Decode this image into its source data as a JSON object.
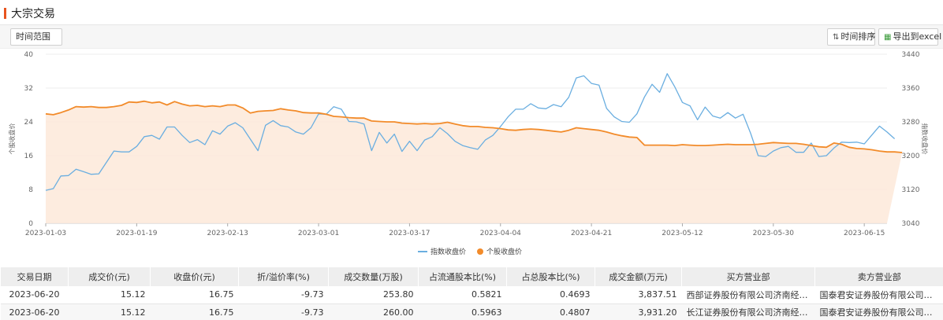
{
  "panel": {
    "title": "大宗交易"
  },
  "toolbar": {
    "range_label": "时间范围",
    "sort_label": "时间排序",
    "sort_icon": "sort-icon",
    "export_label": "导出到excel",
    "export_icon": "excel-icon"
  },
  "chart_data": {
    "type": "line",
    "x": [
      "2023-01-03",
      "2023-01-04",
      "2023-01-05",
      "2023-01-06",
      "2023-01-09",
      "2023-01-10",
      "2023-01-11",
      "2023-01-12",
      "2023-01-13",
      "2023-01-16",
      "2023-01-17",
      "2023-01-18",
      "2023-01-19",
      "2023-01-20",
      "2023-01-30",
      "2023-01-31",
      "2023-02-01",
      "2023-02-02",
      "2023-02-03",
      "2023-02-06",
      "2023-02-07",
      "2023-02-08",
      "2023-02-09",
      "2023-02-10",
      "2023-02-13",
      "2023-02-14",
      "2023-02-15",
      "2023-02-16",
      "2023-02-17",
      "2023-02-20",
      "2023-02-21",
      "2023-02-22",
      "2023-02-23",
      "2023-02-24",
      "2023-02-27",
      "2023-02-28",
      "2023-03-01",
      "2023-03-02",
      "2023-03-03",
      "2023-03-06",
      "2023-03-07",
      "2023-03-08",
      "2023-03-09",
      "2023-03-10",
      "2023-03-13",
      "2023-03-14",
      "2023-03-15",
      "2023-03-16",
      "2023-03-17",
      "2023-03-20",
      "2023-03-21",
      "2023-03-22",
      "2023-03-23",
      "2023-03-24",
      "2023-03-27",
      "2023-03-28",
      "2023-03-29",
      "2023-03-30",
      "2023-03-31",
      "2023-04-03",
      "2023-04-04",
      "2023-04-06",
      "2023-04-07",
      "2023-04-10",
      "2023-04-11",
      "2023-04-12",
      "2023-04-13",
      "2023-04-14",
      "2023-04-17",
      "2023-04-18",
      "2023-04-19",
      "2023-04-20",
      "2023-04-21",
      "2023-04-24",
      "2023-04-25",
      "2023-04-26",
      "2023-04-27",
      "2023-04-28",
      "2023-05-04",
      "2023-05-05",
      "2023-05-08",
      "2023-05-09",
      "2023-05-10",
      "2023-05-11",
      "2023-05-12",
      "2023-05-15",
      "2023-05-16",
      "2023-05-17",
      "2023-05-18",
      "2023-05-19",
      "2023-05-22",
      "2023-05-23",
      "2023-05-24",
      "2023-05-25",
      "2023-05-26",
      "2023-05-29",
      "2023-05-30",
      "2023-05-31",
      "2023-06-01",
      "2023-06-02",
      "2023-06-05",
      "2023-06-06",
      "2023-06-07",
      "2023-06-08",
      "2023-06-09",
      "2023-06-12",
      "2023-06-13",
      "2023-06-14",
      "2023-06-15",
      "2023-06-16",
      "2023-06-19",
      "2023-06-20"
    ],
    "x_ticks": [
      "2023-01-03",
      "2023-01-19",
      "2023-02-13",
      "2023-03-01",
      "2023-03-17",
      "2023-04-04",
      "2023-04-21",
      "2023-05-12",
      "2023-05-30",
      "2023-06-15"
    ],
    "ylim_left": [
      0,
      40
    ],
    "yticks_left": [
      "40",
      "32",
      "24",
      "16",
      "8",
      "0"
    ],
    "ylim_right": [
      3040,
      3440
    ],
    "yticks_right": [
      "3440",
      "3360",
      "3280",
      "3200",
      "3120",
      "3040"
    ],
    "ylabel_left": "个股收盘价",
    "ylabel_right": "指数收盘价",
    "series": [
      {
        "name": "指数收盘价",
        "axis": "right",
        "color": "#6aaee0",
        "values": [
          3118,
          3122,
          3152,
          3153,
          3168,
          3162,
          3156,
          3157,
          3184,
          3211,
          3209,
          3209,
          3222,
          3245,
          3248,
          3239,
          3268,
          3268,
          3248,
          3231,
          3238,
          3226,
          3259,
          3251,
          3270,
          3278,
          3266,
          3239,
          3212,
          3272,
          3283,
          3271,
          3268,
          3256,
          3251,
          3266,
          3299,
          3298,
          3316,
          3310,
          3281,
          3280,
          3275,
          3212,
          3255,
          3230,
          3251,
          3210,
          3234,
          3212,
          3237,
          3245,
          3266,
          3252,
          3234,
          3224,
          3219,
          3215,
          3237,
          3248,
          3269,
          3292,
          3310,
          3310,
          3323,
          3313,
          3311,
          3321,
          3316,
          3338,
          3384,
          3389,
          3371,
          3367,
          3312,
          3292,
          3281,
          3279,
          3299,
          3339,
          3369,
          3350,
          3394,
          3363,
          3326,
          3318,
          3285,
          3315,
          3294,
          3289,
          3302,
          3289,
          3298,
          3253,
          3200,
          3198,
          3211,
          3219,
          3222,
          3208,
          3208,
          3230,
          3198,
          3200,
          3218,
          3232,
          3231,
          3232,
          3228,
          3249,
          3270,
          3256,
          3240
        ]
      },
      {
        "name": "个股收盘价",
        "axis": "left",
        "color": "#f28b2a",
        "fill": "#fde9d9",
        "values": [
          25.9,
          25.7,
          26.2,
          26.8,
          27.6,
          27.5,
          27.6,
          27.4,
          27.4,
          27.6,
          27.9,
          28.7,
          28.6,
          28.9,
          28.5,
          28.7,
          28.0,
          28.8,
          28.2,
          27.8,
          27.9,
          27.6,
          27.8,
          27.6,
          28.0,
          28.0,
          27.3,
          26.1,
          26.5,
          26.6,
          26.7,
          27.1,
          26.8,
          26.6,
          26.2,
          26.1,
          26.1,
          25.8,
          25.3,
          25.2,
          25.0,
          24.9,
          24.9,
          24.2,
          24.1,
          24.0,
          24.0,
          23.7,
          23.6,
          23.5,
          23.6,
          23.5,
          23.6,
          23.9,
          23.5,
          23.1,
          22.9,
          22.9,
          22.7,
          22.6,
          22.4,
          22.1,
          22.0,
          22.2,
          22.3,
          22.2,
          22.0,
          21.8,
          21.6,
          22.0,
          22.6,
          22.4,
          22.2,
          22.0,
          21.6,
          21.1,
          20.7,
          20.4,
          20.3,
          18.5,
          18.5,
          18.5,
          18.5,
          18.4,
          18.6,
          18.5,
          18.4,
          18.4,
          18.5,
          18.6,
          18.7,
          18.6,
          18.6,
          18.6,
          18.7,
          18.9,
          19.1,
          19.0,
          18.9,
          18.9,
          18.7,
          18.4,
          18.1,
          18.0,
          19.0,
          18.7,
          18.0,
          17.7,
          17.6,
          17.4,
          17.1,
          16.9,
          16.9,
          16.75
        ]
      }
    ],
    "legend": [
      "指数收盘价",
      "个股收盘价"
    ],
    "legend_position": "bottom-center"
  },
  "table": {
    "columns": [
      "交易日期",
      "成交价(元)",
      "收盘价(元)",
      "折/溢价率(%)",
      "成交数量(万股)",
      "占流通股本比(%)",
      "占总股本比(%)",
      "成交金额(万元)",
      "买方营业部",
      "卖方营业部"
    ],
    "rows": [
      [
        "2023-06-20",
        "15.12",
        "16.75",
        "-9.73",
        "253.80",
        "0.5821",
        "0.4693",
        "3,837.51",
        "西部证券股份有限公司济南经十路...",
        "国泰君安证券股份有限公司瑞尔果..."
      ],
      [
        "2023-06-20",
        "15.12",
        "16.75",
        "-9.73",
        "260.00",
        "0.5963",
        "0.4807",
        "3,931.20",
        "长江证券股份有限公司济南经十路...",
        "国泰君安证券股份有限公司瑞尔果..."
      ]
    ]
  }
}
